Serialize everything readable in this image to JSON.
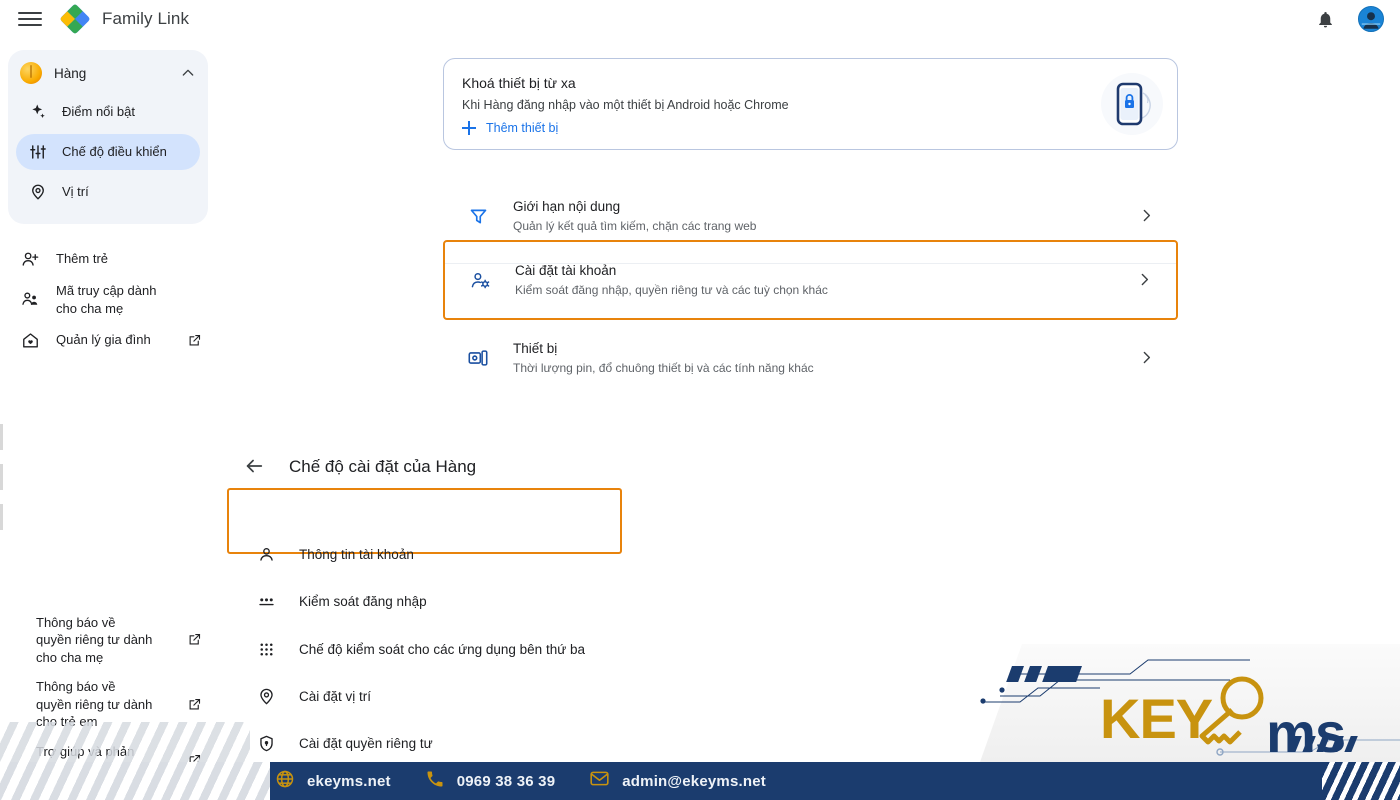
{
  "header": {
    "menu_icon": "hamburger-menu-icon",
    "logo_icon": "family-link-logo-icon",
    "title": "Family Link",
    "bell_icon": "notifications-bell-icon",
    "avatar_icon": "user-avatar"
  },
  "sidebar": {
    "child": {
      "name": "Hàng",
      "collapse_icon": "chevron-up-icon",
      "items": [
        {
          "label": "Điểm nổi bật",
          "icon": "sparkle-icon",
          "selected": false
        },
        {
          "label": "Chế độ điều khiển",
          "icon": "tune-sliders-icon",
          "selected": true
        },
        {
          "label": "Vị trí",
          "icon": "location-pin-icon",
          "selected": false
        }
      ]
    },
    "actions": [
      {
        "label": "Thêm trẻ",
        "icon": "person-add-icon",
        "external": false
      },
      {
        "label": "Mã truy cập dành cho cha mẹ",
        "icon": "supervisor-account-icon",
        "external": false
      },
      {
        "label": "Quản lý gia đình",
        "icon": "home-heart-icon",
        "external": true
      }
    ],
    "footer": [
      {
        "label": "Thông báo về quyền riêng tư dành cho cha mẹ",
        "icon": "external-link-icon",
        "external": true
      },
      {
        "label": "Thông báo về quyền riêng tư dành cho trẻ em",
        "icon": "external-link-icon",
        "external": true
      },
      {
        "label": "Trợ giúp và phản hồi",
        "icon": "external-link-icon",
        "external": true
      }
    ]
  },
  "main": {
    "lock_card": {
      "title": "Khoá thiết bị từ xa",
      "subtitle": "Khi Hàng đăng nhập vào một thiết bị Android hoặc Chrome",
      "action_label": "Thêm thiết bị",
      "action_icon": "plus-icon",
      "art_icon": "phone-lock-illustration"
    },
    "rows": [
      {
        "title": "Giới hạn nội dung",
        "subtitle": "Quản lý kết quả tìm kiếm, chặn các trang web",
        "icon": "filter-funnel-icon",
        "chevron": "chevron-right-icon",
        "highlighted": false
      },
      {
        "title": "Cài đặt tài khoản",
        "subtitle": "Kiểm soát đăng nhập, quyền riêng tư và các tuỳ chọn khác",
        "icon": "account-settings-icon",
        "chevron": "chevron-right-icon",
        "highlighted": true
      },
      {
        "title": "Thiết bị",
        "subtitle": "Thời lượng pin, đổ chuông thiết bị và các tính năng khác",
        "icon": "devices-icon",
        "chevron": "chevron-right-icon",
        "highlighted": false
      }
    ]
  },
  "sub_panel": {
    "back_icon": "arrow-back-icon",
    "title": "Chế độ cài đặt của Hàng",
    "items": [
      {
        "label": "Thông tin tài khoản",
        "icon": "person-icon",
        "highlighted": true
      },
      {
        "label": "Kiểm soát đăng nhập",
        "icon": "password-dots-icon",
        "highlighted": false
      },
      {
        "label": "Chế độ kiểm soát cho các ứng dụng bên thứ ba",
        "icon": "apps-grid-icon",
        "highlighted": false
      },
      {
        "label": "Cài đặt vị trí",
        "icon": "location-pin-icon",
        "highlighted": false
      },
      {
        "label": "Cài đặt quyền riêng tư",
        "icon": "shield-privacy-icon",
        "highlighted": false
      }
    ]
  },
  "banner": {
    "website": "ekeyms.net",
    "website_icon": "globe-icon",
    "phone": "0969 38 36 39",
    "phone_icon": "phone-icon",
    "email": "admin@ekeyms.net",
    "email_icon": "envelope-icon",
    "brand_key": "KEY",
    "brand_ms": "ms"
  },
  "colors": {
    "accent_blue": "#1a73e8",
    "highlight_orange": "#e8830c",
    "sidebar_selected": "#d3e3fd",
    "banner_navy": "#1b3c6e",
    "brand_gold": "#c8930f"
  }
}
